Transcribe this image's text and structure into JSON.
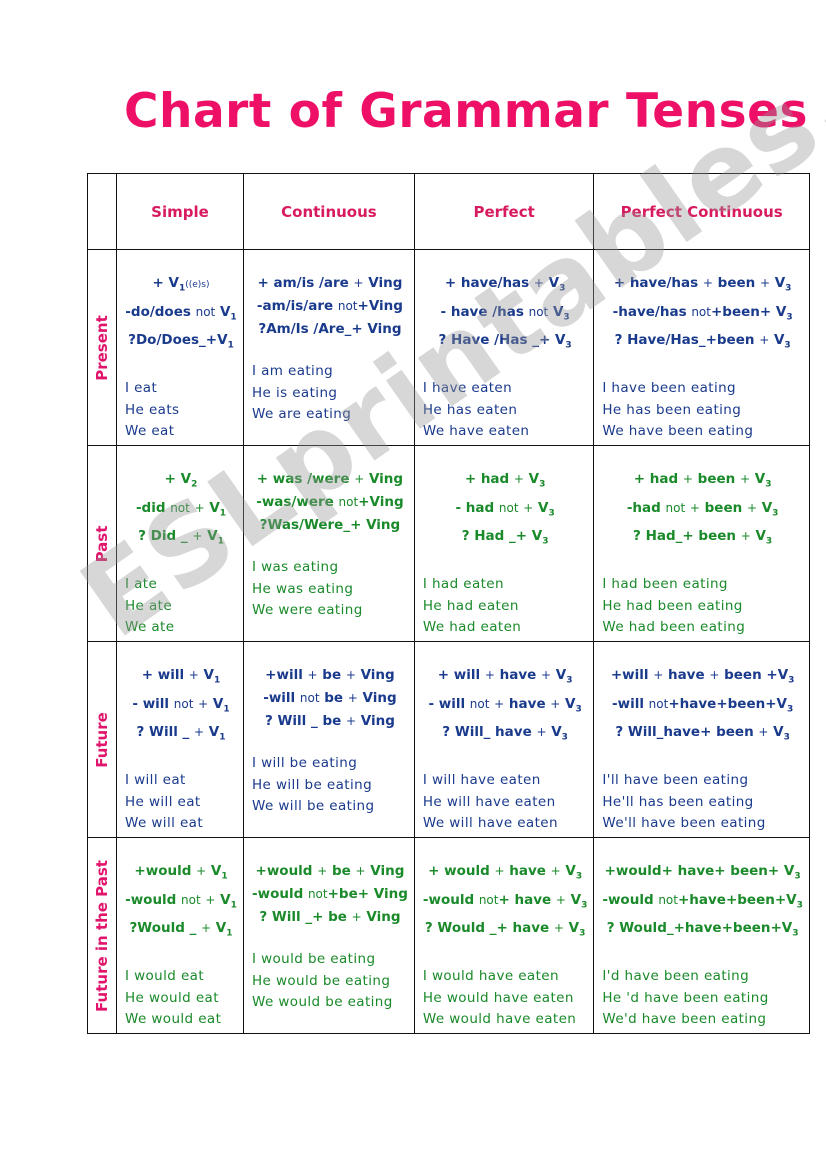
{
  "title": "Chart of Grammar Tenses",
  "watermark": "ESLprintables.com",
  "colors": {
    "title": "#ee1066",
    "header": "#d81b60",
    "blue": "#1a3a8c",
    "green": "#1a8a2a"
  },
  "columns": [
    "Simple",
    "Continuous",
    "Perfect",
    "Perfect Continuous"
  ],
  "rows": [
    {
      "label": "Present",
      "color": "blue",
      "cells": [
        {
          "formulas": [
            "+ V1((e)s)",
            "-do/does not V1",
            "?Do/Does_+V1"
          ],
          "examples": [
            "I  eat",
            "He  eats",
            "We  eat"
          ]
        },
        {
          "formulas": [
            "+ am/is /are + Ving",
            "-am/is/are not+Ving",
            "?Am/Is /Are_+ Ving"
          ],
          "examples": [
            "I  am  eating",
            "He  is  eating",
            "We   are  eating"
          ]
        },
        {
          "formulas": [
            "+ have/has + V3",
            "- have /has not V3",
            "? Have /Has _+ V3"
          ],
          "examples": [
            "I  have eaten",
            "He  has eaten",
            "We  have eaten"
          ]
        },
        {
          "formulas": [
            "+ have/has + been + V3",
            "-have/has not+been+ V3",
            "? Have/Has_+been + V3"
          ],
          "examples": [
            "I  have  been  eating",
            "He  has  been  eating",
            "We  have  been eating"
          ]
        }
      ]
    },
    {
      "label": "Past",
      "color": "green",
      "cells": [
        {
          "formulas": [
            "+ V2",
            "-did not +  V1",
            "? Did _ + V1"
          ],
          "examples": [
            "I  ate",
            "He  ate",
            "We  ate"
          ]
        },
        {
          "formulas": [
            "+ was /were + Ving",
            "-was/were not+Ving",
            "?Was/Were_+ Ving"
          ],
          "examples": [
            "I  was  eating",
            "He  was  eating",
            "We  were eating"
          ]
        },
        {
          "formulas": [
            "+ had + V3",
            "- had not +  V3",
            "? Had _+ V3"
          ],
          "examples": [
            "I  had  eaten",
            "He  had  eaten",
            "We  had  eaten"
          ]
        },
        {
          "formulas": [
            "+ had + been + V3",
            "-had not + been + V3",
            "? Had_+ been + V3"
          ],
          "examples": [
            "I  had  been  eating",
            "He  had  been  eating",
            "We  had  been  eating"
          ]
        }
      ]
    },
    {
      "label": "Future",
      "color": "blue",
      "cells": [
        {
          "formulas": [
            "+ will + V1",
            "- will not +  V1",
            "? Will _ + V1"
          ],
          "examples": [
            "I  will  eat",
            "He  will  eat",
            "We  will  eat"
          ]
        },
        {
          "formulas": [
            "+will + be + Ving",
            "-will not be + Ving",
            "? Will _ be + Ving"
          ],
          "examples": [
            "I will  be  eating",
            "He  will  be  eating",
            "We  will  be  eating"
          ]
        },
        {
          "formulas": [
            "+ will +  have + V3",
            "- will not + have + V3",
            "? Will_ have + V3"
          ],
          "examples": [
            "I  will have eaten",
            "He  will have eaten",
            "We will have eaten"
          ]
        },
        {
          "formulas": [
            "+will + have + been +V3",
            "-will not+have+been+V3",
            "? Will_have+ been + V3"
          ],
          "examples": [
            "I'll have been eating",
            "He'll has been eating",
            "We'll have been eating"
          ]
        }
      ]
    },
    {
      "label": "Future in the Past",
      "color": "green",
      "cells": [
        {
          "formulas": [
            "+would + V1",
            "-would not + V1",
            "?Would _ + V1"
          ],
          "examples": [
            "I  would  eat",
            "He  would  eat",
            "We  would  eat"
          ]
        },
        {
          "formulas": [
            "+would + be + Ving",
            "-would not+be+ Ving",
            "? Will _+ be + Ving"
          ],
          "examples": [
            "I  would be  eating",
            "He  would be  eating",
            "We  would be  eating"
          ]
        },
        {
          "formulas": [
            "+ would + have + V3",
            "-would not+ have + V3",
            "? Would _+ have + V3"
          ],
          "examples": [
            "I  would have eaten",
            "He  would have eaten",
            "We  would have eaten"
          ]
        },
        {
          "formulas": [
            "+would+ have+ been+ V3",
            "-would not+have+been+V3",
            "? Would_+have+been+V3"
          ],
          "examples": [
            "I'd have been eating",
            "He 'd have been eating",
            "We'd have been eating"
          ]
        }
      ]
    }
  ]
}
